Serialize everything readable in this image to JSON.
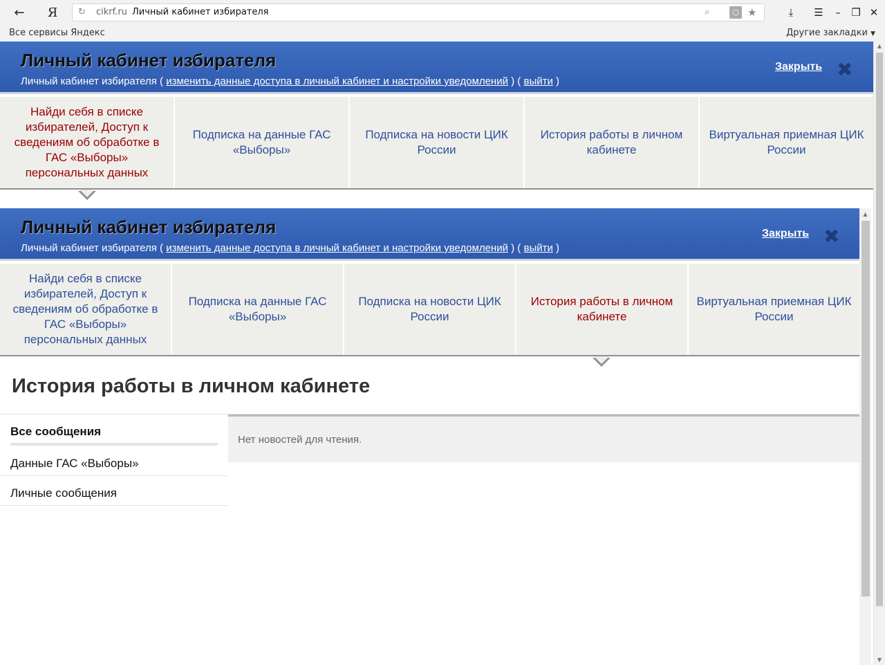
{
  "browser": {
    "back_icon": "arrow-left-icon",
    "yandex_logo": "Я",
    "domain": "cikrf.ru",
    "page_title": "Личный кабинет избирателя",
    "bookmarks_left": "Все сервисы Яндекс",
    "bookmarks_right": "Другие закладки"
  },
  "panel": {
    "title": "Личный кабинет избирателя",
    "sub_prefix": "Личный кабинет избирателя (",
    "sub_link1": "изменить данные доступа в личный кабинет и настройки уведомлений",
    "sub_mid": ") (",
    "sub_link2": "выйти",
    "sub_suffix": ")",
    "close_label": "Закрыть"
  },
  "tabs": [
    {
      "label": "Найди себя в списке избирателей, Доступ к сведениям об обработке в ГАС «Выборы» персональных данных"
    },
    {
      "label": "Подписка на данные ГАС «Выборы»"
    },
    {
      "label": "Подписка на новости ЦИК России"
    },
    {
      "label": "История работы в личном кабинете"
    },
    {
      "label": "Виртуальная приемная ЦИК России"
    }
  ],
  "main": {
    "heading": "История работы в личном кабинете",
    "sidebar": [
      {
        "label": "Все сообщения"
      },
      {
        "label": "Данные ГАС «Выборы»"
      },
      {
        "label": "Личные сообщения"
      }
    ],
    "empty_text": "Нет новостей для чтения."
  }
}
